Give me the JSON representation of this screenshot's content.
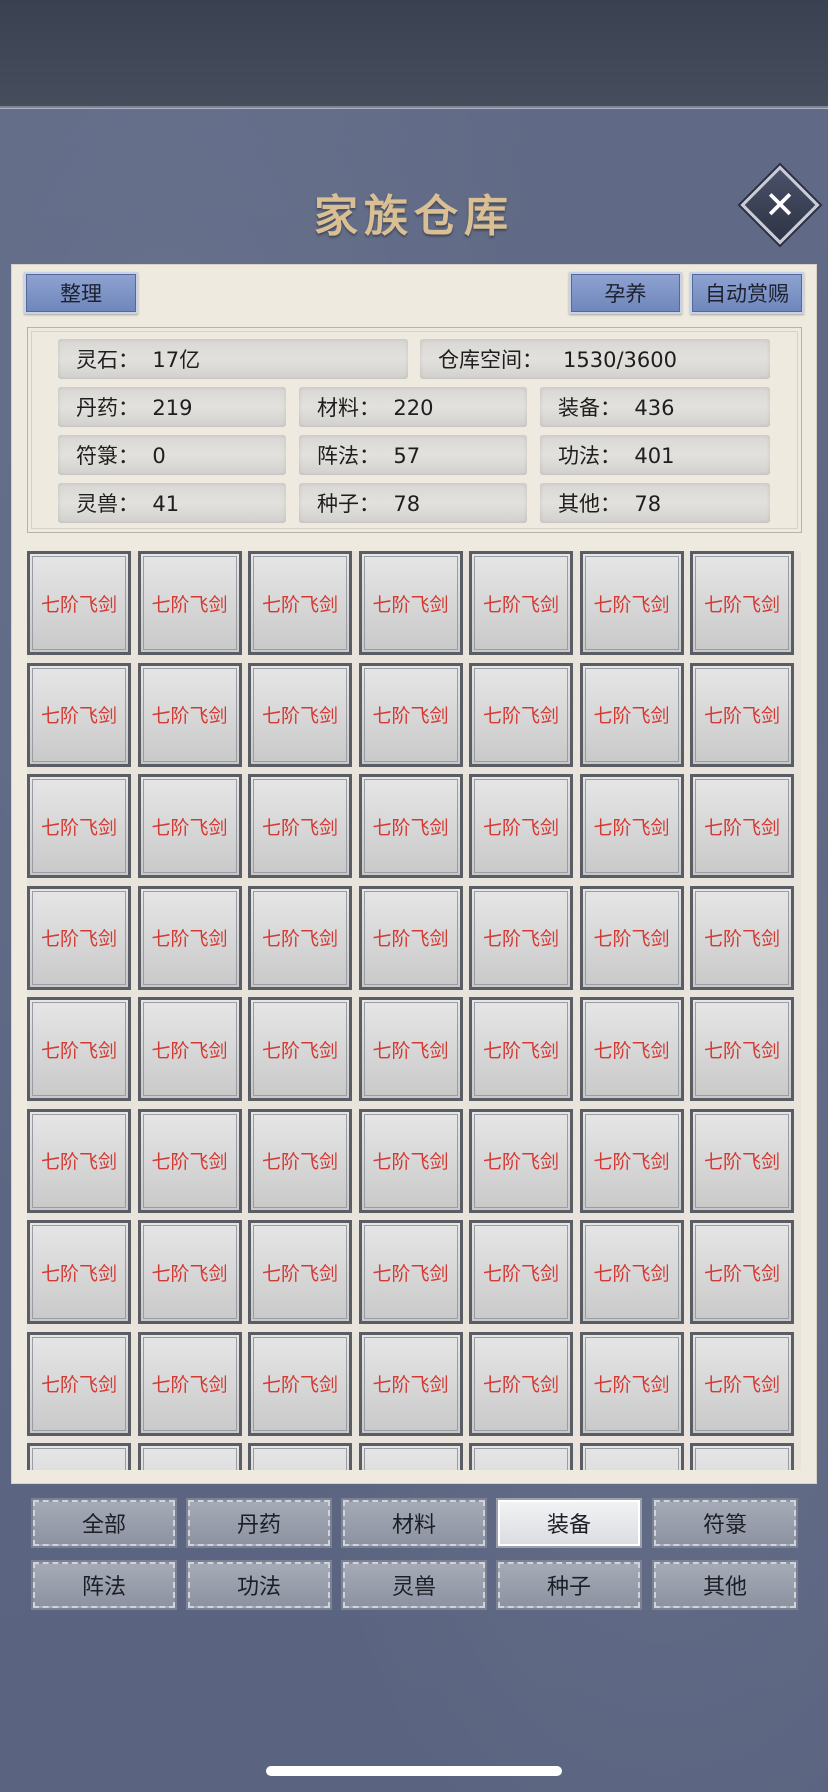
{
  "title": "家族仓库",
  "close_label": "✕",
  "actions": {
    "sort": "整理",
    "breed": "孕养",
    "auto_reward": "自动赏赐"
  },
  "stats": {
    "spirit_stone": "灵石：  17亿",
    "capacity": "仓库空间：   1530/3600",
    "pill": "丹药：  219",
    "material": "材料：  220",
    "equipment": "装备：  436",
    "talisman": "符箓：  0",
    "formation": "阵法：  57",
    "technique": "功法：  401",
    "beast": "灵兽：  41",
    "seed": "种子：  78",
    "other": "其他：  78"
  },
  "item_label": "七阶飞剑",
  "visible_rows": 9,
  "columns": 7,
  "tabs": [
    "全部",
    "丹药",
    "材料",
    "装备",
    "符箓",
    "阵法",
    "功法",
    "灵兽",
    "种子",
    "其他"
  ],
  "active_tab": 3,
  "colors": {
    "item_text": "#d43a34",
    "title": "#d9bf93",
    "accent_button": "#7f93c6"
  }
}
